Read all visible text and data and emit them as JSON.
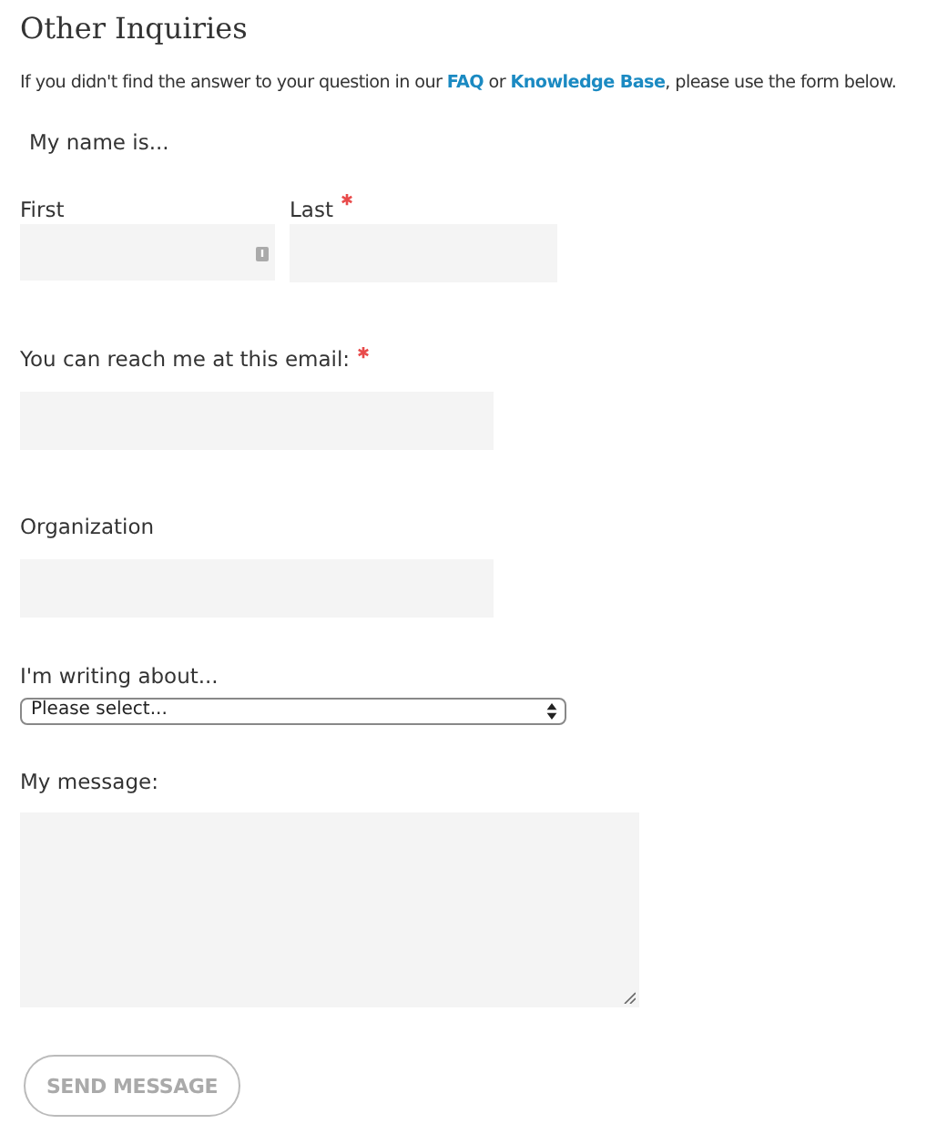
{
  "heading": "Other Inquiries",
  "intro_parts": [
    {
      "text": "If you didn't find the answer to your question in our ",
      "kind": "text"
    },
    {
      "text": "FAQ",
      "kind": "link"
    },
    {
      "text": " or ",
      "kind": "text"
    },
    {
      "text": "Knowledge Base",
      "kind": "link"
    },
    {
      "text": ", please use the form below.",
      "kind": "text"
    }
  ],
  "name_legend": "My name is...",
  "name_fields": [
    {
      "label": "First",
      "required": false,
      "key_icon": true
    },
    {
      "label": "Last",
      "required": true,
      "key_icon": false
    }
  ],
  "fields": [
    {
      "label": "You can reach me at this email:",
      "required": true,
      "kind": "input"
    },
    {
      "label": "Organization",
      "required": false,
      "kind": "input"
    },
    {
      "label": "I'm writing about...",
      "required": false,
      "kind": "select",
      "value": "Please select..."
    },
    {
      "label": "My message:",
      "required": false,
      "kind": "textarea"
    }
  ],
  "submit": "SEND MESSAGE"
}
